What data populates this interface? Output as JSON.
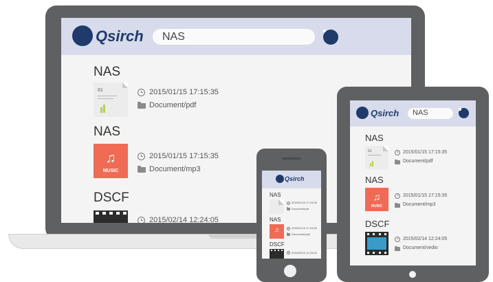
{
  "app": {
    "name": "Qsirch"
  },
  "search": {
    "query": "NAS"
  },
  "results": [
    {
      "title": "NAS",
      "datetime": "2015/01/15 17:15:35",
      "path": "Document/pdf",
      "type": "pdf"
    },
    {
      "title": "NAS",
      "datetime": "2015/01/15 17:15:35",
      "path": "Document/mp3",
      "type": "mp3"
    },
    {
      "title": "DSCF",
      "datetime": "2015/02/14 12:24:05",
      "path": "Document/vedio",
      "type": "video"
    }
  ],
  "thumbs": {
    "pdf_number": "01",
    "mp3_note": "♫",
    "mp3_label": "MUSIC"
  },
  "colors": {
    "brand": "#1f3a6b",
    "accent": "#9cc93a",
    "header_bg": "#d7dbeb",
    "device": "#5f6062",
    "mp3_thumb": "#ef6b56"
  }
}
